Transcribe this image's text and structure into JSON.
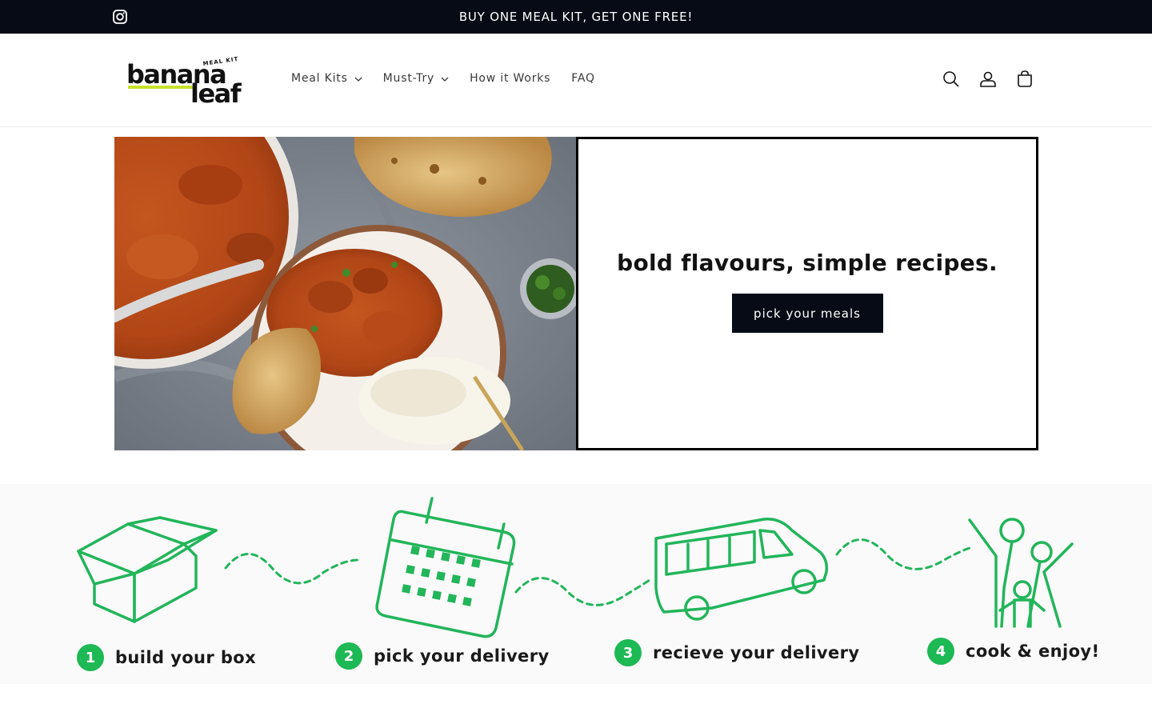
{
  "announcement": {
    "text": "BUY ONE MEAL KIT, GET ONE FREE!",
    "social_icon": "instagram-icon"
  },
  "brand": {
    "logo_top": "MEAL KIT",
    "logo_line1": "banana",
    "logo_line2": "leaf",
    "accent": "#c6e22a"
  },
  "nav": {
    "items": [
      {
        "label": "Meal Kits",
        "dropdown": true
      },
      {
        "label": "Must-Try",
        "dropdown": true
      },
      {
        "label": "How it Works",
        "dropdown": false
      },
      {
        "label": "FAQ",
        "dropdown": false
      }
    ]
  },
  "header_icons": [
    "search-icon",
    "account-icon",
    "cart-icon"
  ],
  "hero": {
    "heading": "bold flavours, simple recipes.",
    "button_label": "pick your meals",
    "image": "butter chicken with naan and rice"
  },
  "steps": [
    {
      "number": "1",
      "label": "build your box",
      "icon": "box-icon"
    },
    {
      "number": "2",
      "label": "pick your delivery",
      "icon": "calendar-icon"
    },
    {
      "number": "3",
      "label": "recieve your delivery",
      "icon": "van-icon"
    },
    {
      "number": "4",
      "label": "cook & enjoy!",
      "icon": "family-icon"
    }
  ],
  "colors": {
    "dark": "#070b16",
    "step_green": "#1db954",
    "line_green": "#22b55a"
  }
}
